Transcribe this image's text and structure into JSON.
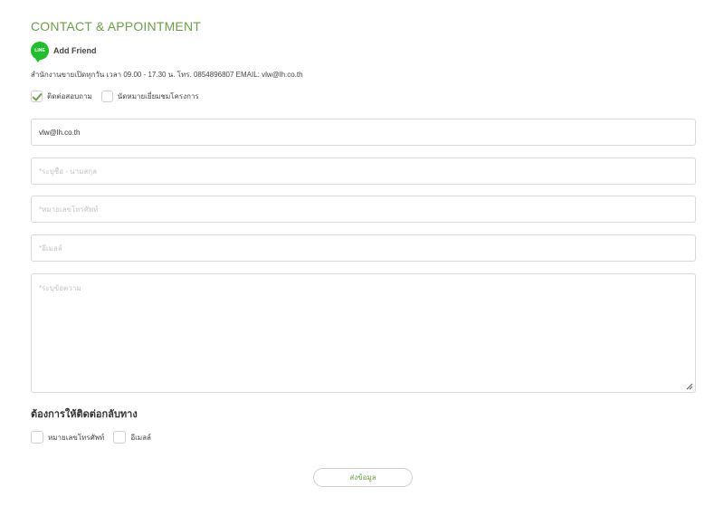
{
  "header": {
    "title": "CONTACT & APPOINTMENT",
    "line_badge_text": "LINE",
    "add_friend": "Add Friend",
    "office_info": "สำนักงานขายเปิดทุกวัน เวลา 09.00 - 17.30 น. โทร. 0854896807 EMAIL: vlw@lh.co.th"
  },
  "inquiry_type": {
    "options": [
      {
        "label": "ติดต่อสอบถาม",
        "checked": true
      },
      {
        "label": "นัดหมายเยี่ยมชมโครงการ",
        "checked": false
      }
    ]
  },
  "form": {
    "email_value": "vlw@lh.co.th",
    "name_placeholder": "*ระบุชื่อ - นามสกุล",
    "phone_placeholder": "*หมายเลขโทรศัพท์",
    "email2_placeholder": "*อีเมลล์",
    "message_placeholder": "*ระบุข้อความ"
  },
  "contact_back": {
    "heading": "ต้องการให้ติดต่อกลับทาง",
    "options": [
      {
        "label": "หมายเลขโทรศัพท์",
        "checked": false
      },
      {
        "label": "อีเมลล์",
        "checked": false
      }
    ]
  },
  "submit_label": "ส่งข้อมูล",
  "colors": {
    "accent": "#6a9f47",
    "line_green": "#1fbf2c",
    "border": "#d9d9d9",
    "placeholder": "#c4c4c4"
  }
}
